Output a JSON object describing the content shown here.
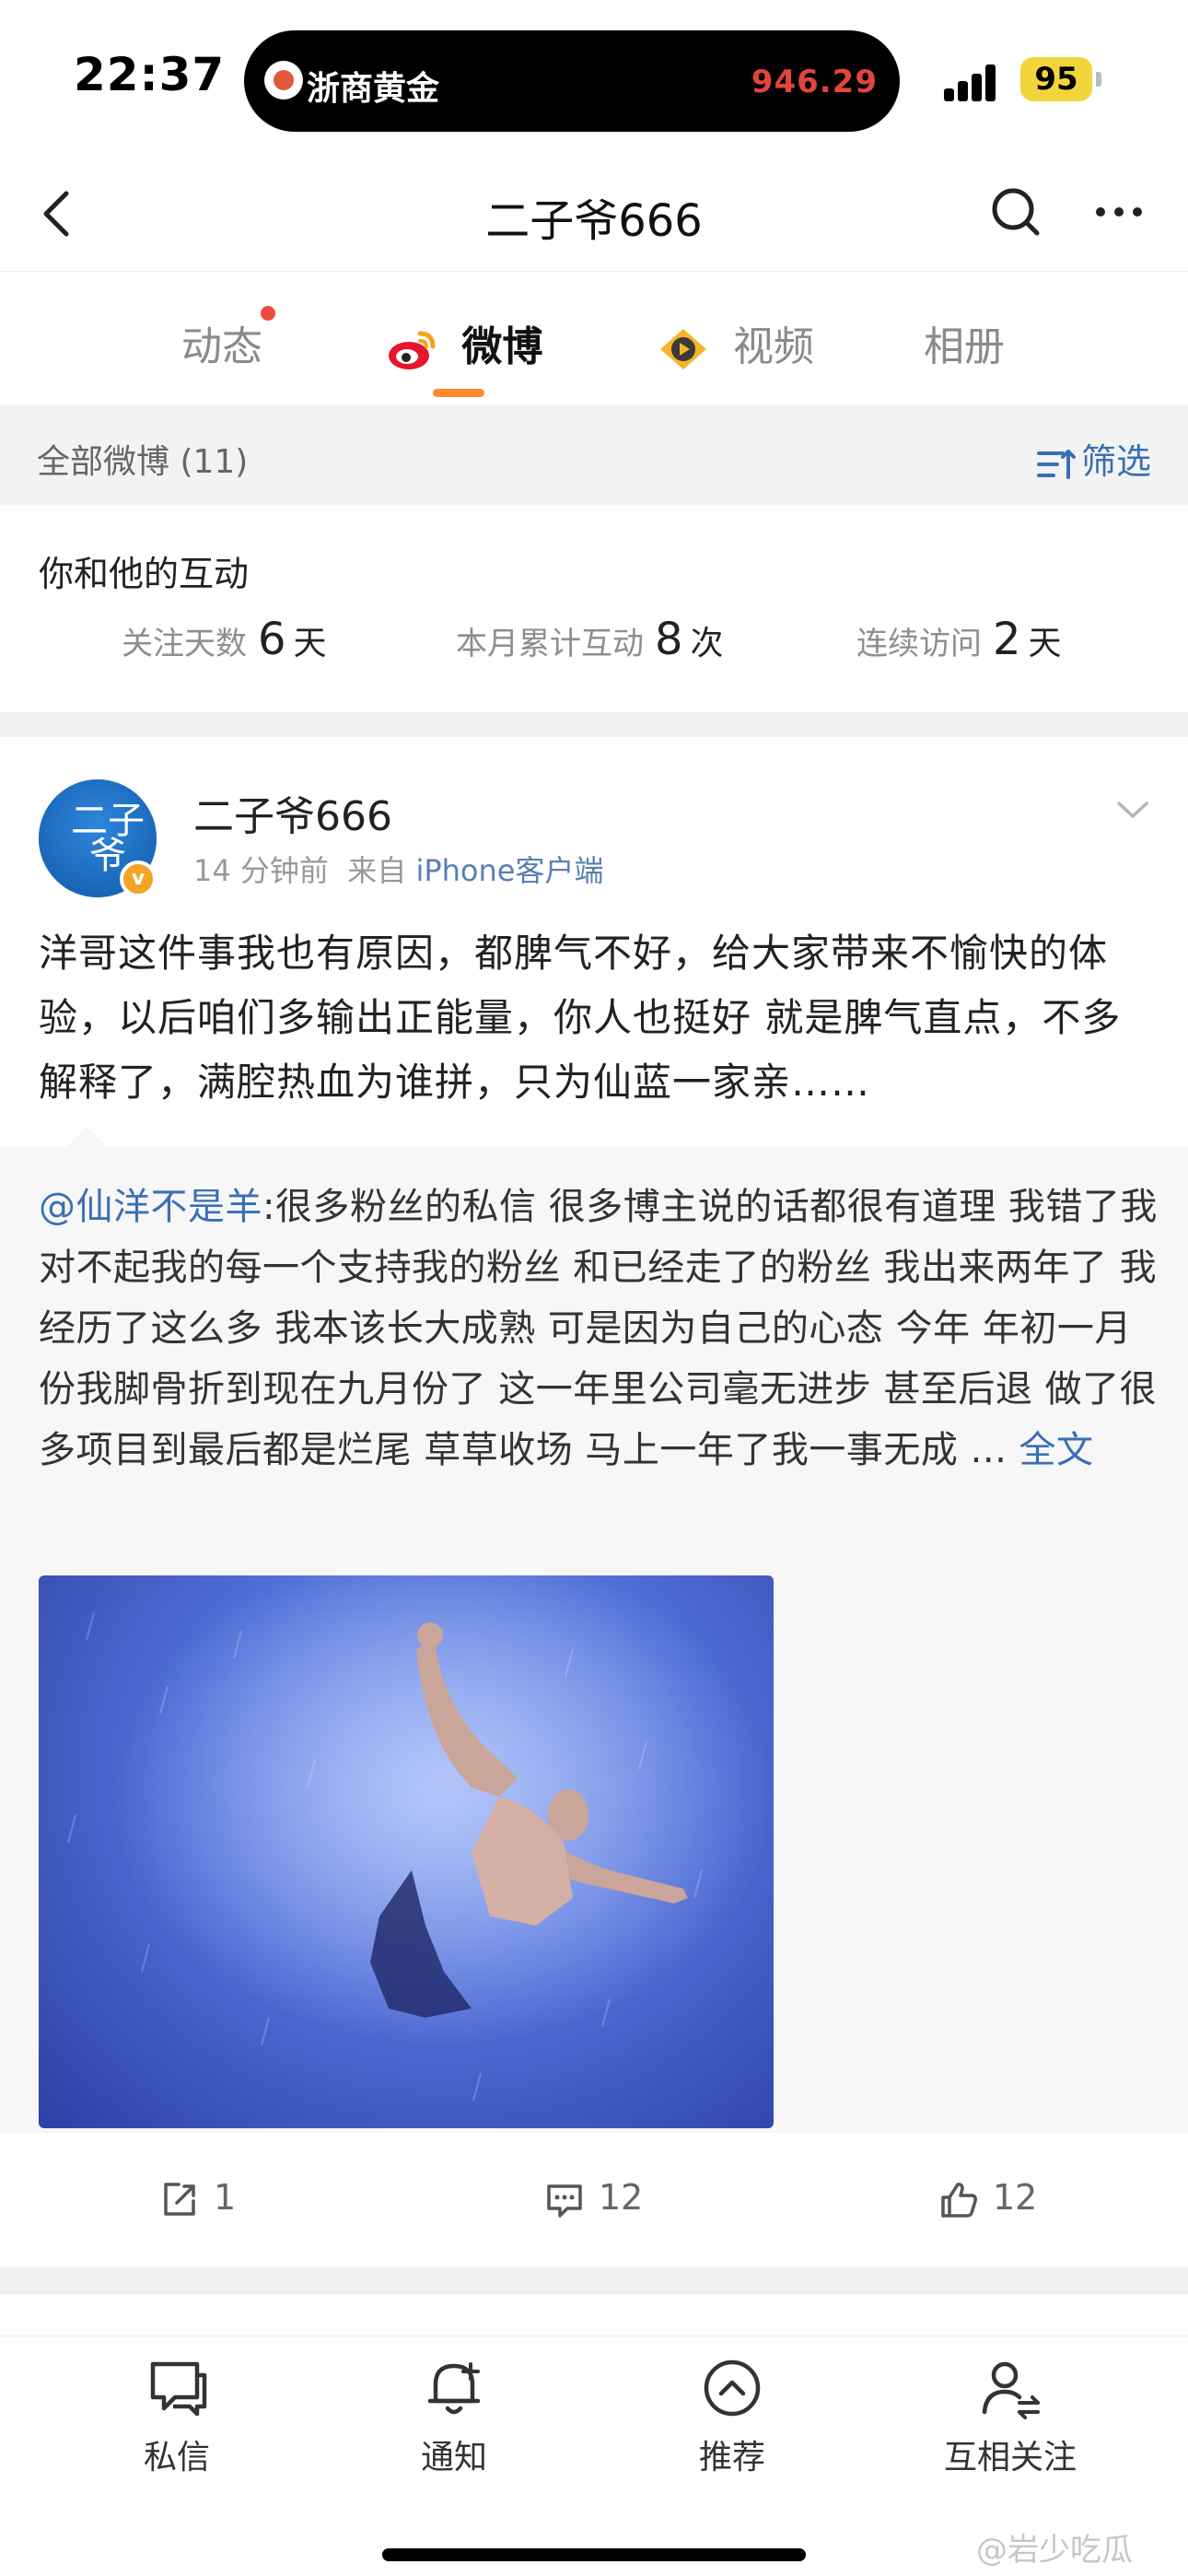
{
  "status_bar": {
    "time": "22:37",
    "island_title": "浙商黄金",
    "island_price": "946.29",
    "battery": "95"
  },
  "nav": {
    "title": "二子爷666"
  },
  "tabs": [
    {
      "label": "动态",
      "has_dot": true
    },
    {
      "label": "微博",
      "active": true
    },
    {
      "label": "视频"
    },
    {
      "label": "相册"
    }
  ],
  "filter": {
    "label": "全部微博 (11)",
    "button": "筛选"
  },
  "interaction": {
    "title": "你和他的互动",
    "stats": [
      {
        "label": "关注天数",
        "value": "6",
        "unit": "天"
      },
      {
        "label": "本月累计互动",
        "value": "8",
        "unit": "次"
      },
      {
        "label": "连续访问",
        "value": "2",
        "unit": "天"
      }
    ]
  },
  "post": {
    "user": "二子爷666",
    "time": "14 分钟前",
    "source_prefix": "来自",
    "source": "iPhone客户端",
    "avatar_text": "二子爷",
    "text": "洋哥这件事我也有原因，都脾气不好，给大家带来不愉快的体验，以后咱们多输出正能量，你人也挺好 就是脾气直点，不多解释了，满腔热血为谁拼，只为仙蓝一家亲……",
    "repost": {
      "user": "@仙洋不是羊",
      "text": ":很多粉丝的私信 很多博主说的话都很有道理 我错了我对不起我的每一个支持我的粉丝 和已经走了的粉丝 我出来两年了 我经历了这么多 我本该长大成熟 可是因为自己的心态 今年 年初一月份我脚骨折到现在九月份了 这一年里公司毫无进步 甚至后退 做了很多项目到最后都是烂尾 草草收场 马上一年了我一事无成 ...",
      "full_text_link": "全文"
    },
    "actions": {
      "share": "1",
      "comment": "12",
      "like": "12"
    }
  },
  "tabbar": [
    {
      "label": "私信",
      "icon": "message-icon"
    },
    {
      "label": "通知",
      "icon": "bell-icon"
    },
    {
      "label": "推荐",
      "icon": "recommend-icon"
    },
    {
      "label": "互相关注",
      "icon": "mutual-follow-icon"
    }
  ],
  "watermark": "@岩少吃瓜",
  "colors": {
    "accent_orange": "#ff8a2b",
    "link_blue": "#3a6fb5",
    "notice_red": "#f04a3d",
    "battery_yellow": "#f2d43b"
  }
}
